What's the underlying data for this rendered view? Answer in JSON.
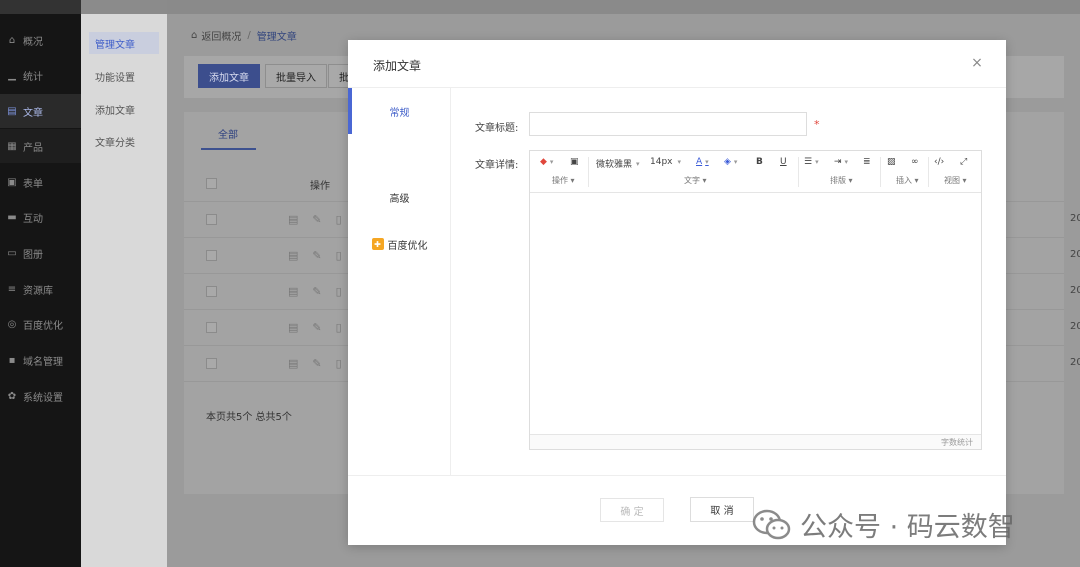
{
  "nav": {
    "items": [
      {
        "icon": "home-icon",
        "glyph": "⌂",
        "label": "概况"
      },
      {
        "icon": "stats-icon",
        "glyph": "▁",
        "label": "统计"
      },
      {
        "icon": "article-icon",
        "glyph": "▤",
        "label": "文章"
      },
      {
        "icon": "product-icon",
        "glyph": "▦",
        "label": "产品"
      },
      {
        "icon": "form-icon",
        "glyph": "▣",
        "label": "表单"
      },
      {
        "icon": "chat-icon",
        "glyph": "▬",
        "label": "互动"
      },
      {
        "icon": "album-icon",
        "glyph": "▭",
        "label": "图册"
      },
      {
        "icon": "database-icon",
        "glyph": "≡",
        "label": "资源库"
      },
      {
        "icon": "baidu-icon",
        "glyph": "◎",
        "label": "百度优化"
      },
      {
        "icon": "domain-icon",
        "glyph": "▪",
        "label": "域名管理"
      },
      {
        "icon": "gear-icon",
        "glyph": "✿",
        "label": "系统设置"
      }
    ]
  },
  "sub": {
    "items": [
      {
        "label": "管理文章"
      },
      {
        "label": "功能设置"
      },
      {
        "label": "添加文章"
      },
      {
        "label": "文章分类"
      }
    ]
  },
  "main": {
    "crumb_back": "返回概况",
    "crumb_sep": "/",
    "crumb_current": "管理文章",
    "toolbar": {
      "add": "添加文章",
      "import": "批量导入",
      "more": "批"
    },
    "tab_all": "全部",
    "col_action": "操作",
    "row_year": "20",
    "pager": "本页共5个  总共5个"
  },
  "modal": {
    "title": "添加文章",
    "close": "×",
    "tabs": {
      "general": "常规",
      "advanced": "高级",
      "baidu": "百度优化"
    },
    "title_label": "文章标题:",
    "title_value": "",
    "required_mark": "*",
    "detail_label": "文章详情:",
    "editor": {
      "font": "微软雅黑",
      "size": "14px",
      "groups": {
        "ops": "操作",
        "text": "文字",
        "layout": "排版",
        "insert": "插入",
        "view": "视图"
      },
      "word_count": "字数统计"
    },
    "ok": "确 定",
    "cancel": "取 消"
  },
  "watermark": "公众号 · 码云数智"
}
